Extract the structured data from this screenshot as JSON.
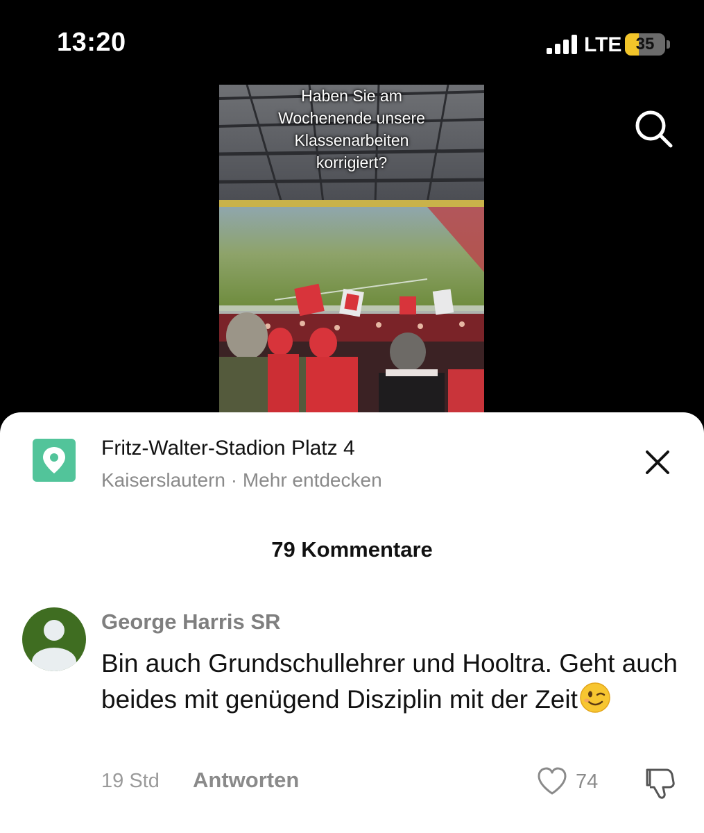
{
  "status_bar": {
    "time": "13:20",
    "network": "LTE",
    "battery_level": "35",
    "battery_fraction": 0.35,
    "signal_bars": 4
  },
  "video": {
    "caption_lines": [
      "Haben Sie am",
      "Wochenende unsere",
      "Klassenarbeiten",
      "korrigiert?"
    ]
  },
  "top_icons": {
    "search": "search-icon"
  },
  "location": {
    "title": "Fritz-Walter-Stadion Platz 4",
    "subtitle": "Kaiserslautern · Mehr entdecken",
    "icon": "location-pin-icon",
    "close_icon": "close-icon"
  },
  "comments": {
    "count_label": "79 Kommentare",
    "items": [
      {
        "author": "George Harris SR",
        "text": "Bin auch Grundschullehrer und Hooltra. Geht auch beides mit genügend Disziplin mit der Zeit",
        "emoji": "winking-face-emoji",
        "time": "19 Std",
        "reply_label": "Antworten",
        "likes": "74"
      }
    ]
  },
  "colors": {
    "accent_green": "#52c49a",
    "battery_yellow": "#f2c52a",
    "avatar_green": "#3f6d21"
  }
}
